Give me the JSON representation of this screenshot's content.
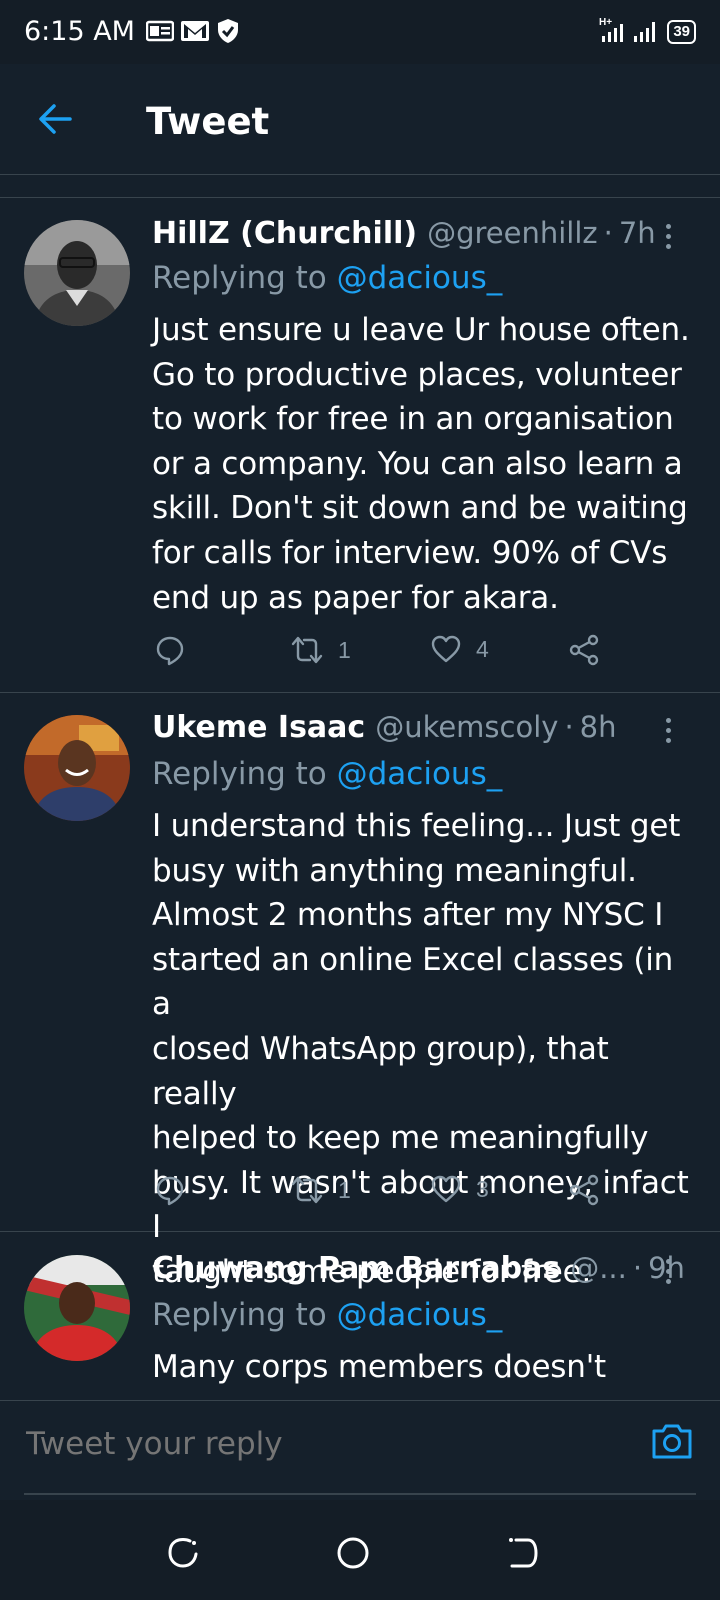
{
  "status_bar": {
    "time": "6:15 AM",
    "battery": "39",
    "network": "H+"
  },
  "header": {
    "title": "Tweet"
  },
  "tweets": [
    {
      "name": "HillZ (Churchill)",
      "handle": "@greenhillz",
      "dot": "·",
      "time": "7h",
      "replying_prefix": "Replying to ",
      "replying_to": "@dacious_",
      "lines": [
        "Just ensure u leave Ur house often.",
        "Go to productive places, volunteer",
        "to work for free in an organisation",
        "or a company. You can also learn a",
        "skill. Don't sit down and be waiting",
        "for calls for interview. 90% of CVs",
        "end up as paper for akara."
      ],
      "retweets": "1",
      "likes": "4"
    },
    {
      "name": "Ukeme Isaac",
      "handle": "@ukemscoly",
      "dot": "·",
      "time": "8h",
      "replying_prefix": "Replying to ",
      "replying_to": "@dacious_",
      "lines": [
        "I understand this feeling... Just get",
        "busy with anything meaningful.",
        "Almost 2 months after my NYSC I",
        "started an online Excel classes (in a",
        "closed WhatsApp group), that really",
        "helped to keep me meaningfully",
        "busy. It wasn't about money, infact I",
        "taught some people for free."
      ],
      "retweets": "1",
      "likes": "3"
    },
    {
      "name": "Chuwang Pam Barnabas",
      "handle": "@...",
      "dot": "·",
      "time": "9h",
      "replying_prefix": "Replying to ",
      "replying_to": "@dacious_",
      "lines": [
        "Many corps members doesn't"
      ]
    }
  ],
  "reply": {
    "placeholder": "Tweet your reply"
  },
  "colors": {
    "background": "#15202b",
    "accent": "#1da1f2",
    "secondary_text": "#8899a6",
    "divider": "#38444d"
  }
}
